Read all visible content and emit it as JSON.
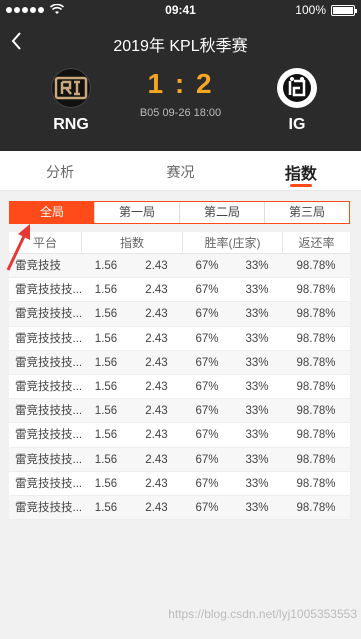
{
  "status": {
    "time": "09:41",
    "battery": "100%"
  },
  "nav": {
    "title": "2019年 KPL秋季赛"
  },
  "match": {
    "home_team": "RNG",
    "away_team": "IG",
    "score": "1 : 2",
    "info": "B05  09-26 18:00"
  },
  "tabs": [
    {
      "label": "分析"
    },
    {
      "label": "赛况"
    },
    {
      "label": "指数"
    }
  ],
  "segments": [
    {
      "label": "全局"
    },
    {
      "label": "第一局"
    },
    {
      "label": "第二局"
    },
    {
      "label": "第三局"
    }
  ],
  "table": {
    "headers": {
      "platform": "平台",
      "index": "指数",
      "winrate": "胜率(庄家)",
      "return": "返还率"
    },
    "rows": [
      [
        "雷竞技技",
        "1.56",
        "2.43",
        "67%",
        "33%",
        "98.78%"
      ],
      [
        "雷竞技技技...",
        "1.56",
        "2.43",
        "67%",
        "33%",
        "98.78%"
      ],
      [
        "雷竞技技技...",
        "1.56",
        "2.43",
        "67%",
        "33%",
        "98.78%"
      ],
      [
        "雷竞技技技...",
        "1.56",
        "2.43",
        "67%",
        "33%",
        "98.78%"
      ],
      [
        "雷竞技技技...",
        "1.56",
        "2.43",
        "67%",
        "33%",
        "98.78%"
      ],
      [
        "雷竞技技技...",
        "1.56",
        "2.43",
        "67%",
        "33%",
        "98.78%"
      ],
      [
        "雷竞技技技...",
        "1.56",
        "2.43",
        "67%",
        "33%",
        "98.78%"
      ],
      [
        "雷竞技技技...",
        "1.56",
        "2.43",
        "67%",
        "33%",
        "98.78%"
      ],
      [
        "雷竞技技技...",
        "1.56",
        "2.43",
        "67%",
        "33%",
        "98.78%"
      ],
      [
        "雷竞技技技...",
        "1.56",
        "2.43",
        "67%",
        "33%",
        "98.78%"
      ],
      [
        "雷竞技技技...",
        "1.56",
        "2.43",
        "67%",
        "33%",
        "98.78%"
      ]
    ]
  },
  "watermark": "https://blog.csdn.net/lyj1005353553",
  "colors": {
    "accent": "#ff4a1a",
    "score": "#f5a623",
    "header_bg": "#2b2b2b"
  },
  "icons": {
    "back": "chevron-left-icon",
    "wifi": "wifi-icon",
    "battery": "battery-icon"
  }
}
